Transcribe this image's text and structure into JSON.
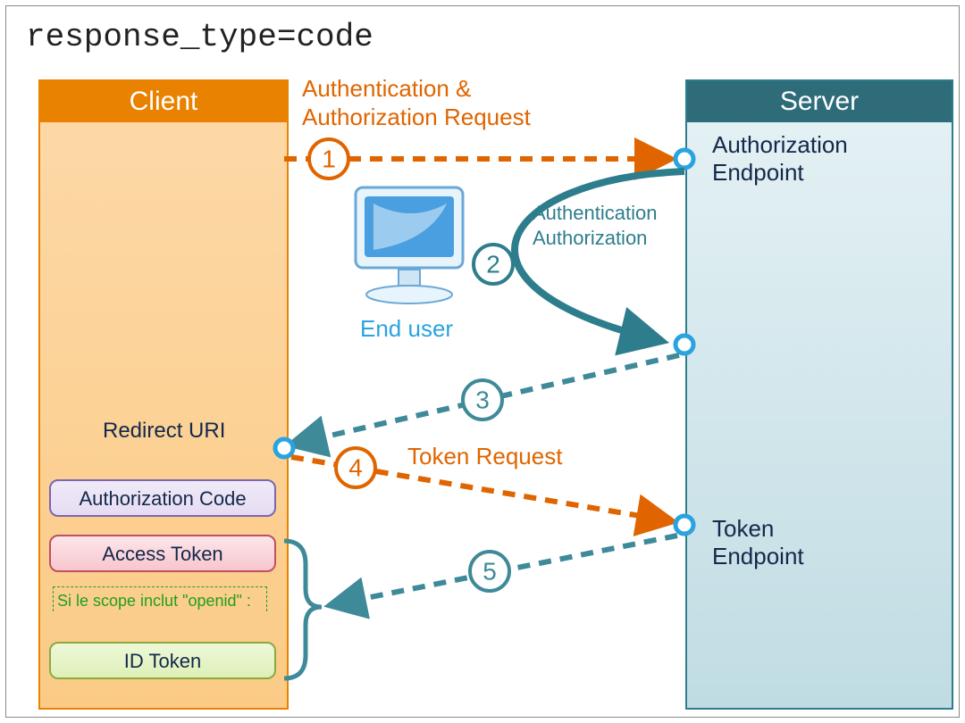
{
  "title": "response_type=code",
  "client": {
    "header": "Client"
  },
  "server": {
    "header": "Server",
    "auth_endpoint": "Authorization\nEndpoint",
    "token_endpoint": "Token\nEndpoint"
  },
  "labels": {
    "redirect_uri": "Redirect URI",
    "end_user": "End user",
    "step1": "Authentication &\nAuthorization Request",
    "step2a": "Authentication",
    "step2b": "Authorization",
    "step4": "Token Request"
  },
  "tokens": {
    "auth_code": "Authorization Code",
    "access_token": "Access Token",
    "id_token": "ID Token",
    "scope_note": "Si le scope inclut \"openid\" :"
  },
  "steps": {
    "s1": "1",
    "s2": "2",
    "s3": "3",
    "s4": "4",
    "s5": "5"
  },
  "colors": {
    "orange": "#e06500",
    "teal": "#3e8a99",
    "dark_teal": "#2e7d8c"
  }
}
